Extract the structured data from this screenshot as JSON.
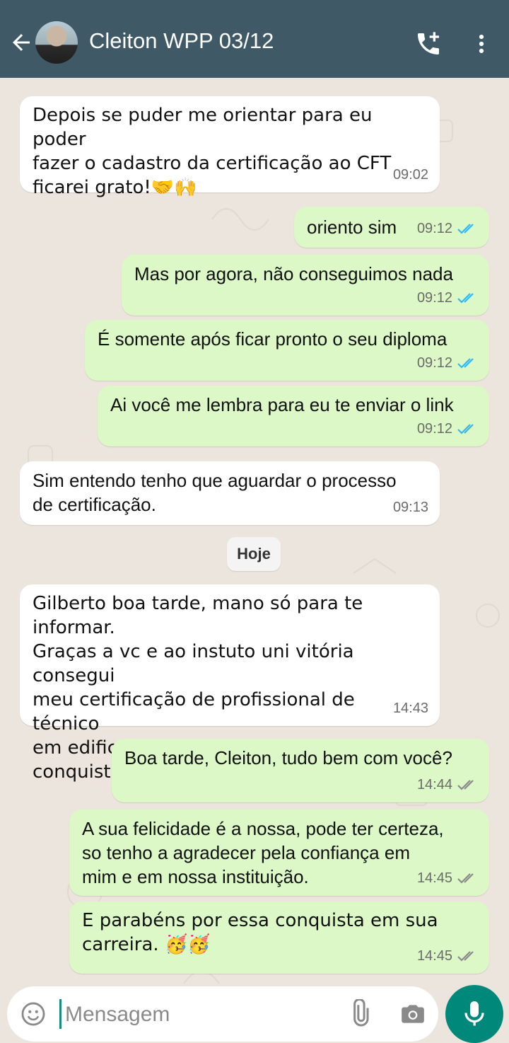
{
  "header": {
    "title": "Cleiton WPP 03/12",
    "icons": [
      "back-arrow-icon",
      "avatar",
      "add-call-icon",
      "more-vert-icon"
    ],
    "colors": {
      "bar": "#3f5a66"
    }
  },
  "messages": [
    {
      "dir": "in",
      "text": "Depois se puder me orientar para eu poder\nfazer o cadastro da certificação ao CFT\nficarei grato!🤝🙌",
      "time": "09:02"
    },
    {
      "dir": "out",
      "text": "oriento sim",
      "time": "09:12",
      "status": "read"
    },
    {
      "dir": "out",
      "text": "Mas por agora, não conseguimos nada",
      "time": "09:12",
      "status": "read"
    },
    {
      "dir": "out",
      "text": "É somente após ficar pronto o seu diploma",
      "time": "09:12",
      "status": "read"
    },
    {
      "dir": "out",
      "text": "Ai você me lembra para eu te enviar o link",
      "time": "09:12",
      "status": "read"
    },
    {
      "dir": "in",
      "text": "Sim entendo tenho que aguardar o processo\nde certificação.",
      "time": "09:13"
    },
    {
      "dir": "in",
      "text": "Gilberto boa tarde, mano só para te informar.\nGraças a vc e ao instuto uni vitória consegui\nmeu certificação de profissional de técnico\nem edificações. Super feliz por essa\nconquista irmão valew🙌🥺🤝👷",
      "time": "14:43"
    },
    {
      "dir": "out",
      "text": "Boa tarde, Cleiton, tudo bem com você?",
      "time": "14:44",
      "status": "delivered"
    },
    {
      "dir": "out",
      "text": "A sua felicidade é a nossa, pode ter certeza,\nso tenho a agradecer pela confiança em\nmim e em nossa instituição.",
      "time": "14:45",
      "status": "delivered"
    },
    {
      "dir": "out",
      "text": "E parabéns por essa conquista em sua\ncarreira. 🥳🥳",
      "time": "14:45",
      "status": "delivered"
    }
  ],
  "day_separator": "Hoje",
  "composer": {
    "placeholder": "Mensagem",
    "icons": [
      "emoji-icon",
      "attach-icon",
      "camera-icon",
      "mic-icon"
    ]
  },
  "colors": {
    "incoming": "#ffffff",
    "outgoing": "#dcf8c6",
    "read_ticks": "#34b7f1",
    "delivered_ticks": "#8a8a8a",
    "mic_button": "#00897b"
  }
}
